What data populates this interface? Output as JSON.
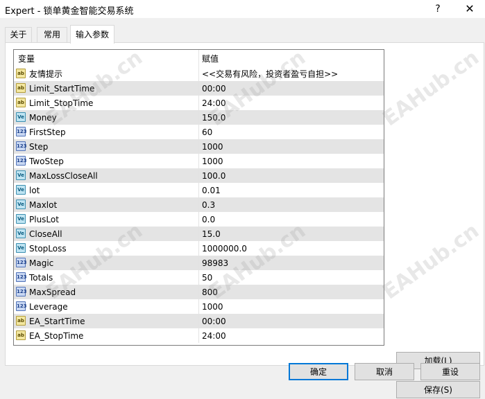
{
  "window": {
    "title": "Expert - 锁单黄金智能交易系统",
    "help_icon": "?",
    "close_icon": "✕"
  },
  "tabs": [
    {
      "label": "关于"
    },
    {
      "label": "常用"
    },
    {
      "label": "输入参数"
    }
  ],
  "table": {
    "columns": [
      "变量",
      "赋值"
    ],
    "rows": [
      {
        "icon": "ab",
        "name": "友情提示",
        "value": "<<交易有风险，投资者盈亏自担>>"
      },
      {
        "icon": "ab",
        "name": "Limit_StartTime",
        "value": "00:00"
      },
      {
        "icon": "ab",
        "name": "Limit_StopTime",
        "value": "24:00"
      },
      {
        "icon": "ve",
        "name": "Money",
        "value": "150.0"
      },
      {
        "icon": "123",
        "name": "FirstStep",
        "value": "60"
      },
      {
        "icon": "123",
        "name": "Step",
        "value": "1000"
      },
      {
        "icon": "123",
        "name": "TwoStep",
        "value": "1000"
      },
      {
        "icon": "ve",
        "name": "MaxLossCloseAll",
        "value": "100.0"
      },
      {
        "icon": "ve",
        "name": "lot",
        "value": "0.01"
      },
      {
        "icon": "ve",
        "name": "Maxlot",
        "value": "0.3"
      },
      {
        "icon": "ve",
        "name": "PlusLot",
        "value": "0.0"
      },
      {
        "icon": "ve",
        "name": "CloseAll",
        "value": "15.0"
      },
      {
        "icon": "ve",
        "name": "StopLoss",
        "value": "1000000.0"
      },
      {
        "icon": "123",
        "name": "Magic",
        "value": "98983"
      },
      {
        "icon": "123",
        "name": "Totals",
        "value": "50"
      },
      {
        "icon": "123",
        "name": "MaxSpread",
        "value": "800"
      },
      {
        "icon": "123",
        "name": "Leverage",
        "value": "1000"
      },
      {
        "icon": "ab",
        "name": "EA_StartTime",
        "value": "00:00"
      },
      {
        "icon": "ab",
        "name": "EA_StopTime",
        "value": "24:00"
      }
    ]
  },
  "icon_labels": {
    "ab": "ab",
    "ve": "Ve",
    "123": "123"
  },
  "buttons": {
    "load": "加载(L)",
    "save": "保存(S)",
    "ok": "确定",
    "cancel": "取消",
    "reset": "重设"
  },
  "watermark": "EAHub.cn",
  "colors": {
    "focus_border": "#0078d7",
    "row_shade": "#e4e4e4"
  }
}
